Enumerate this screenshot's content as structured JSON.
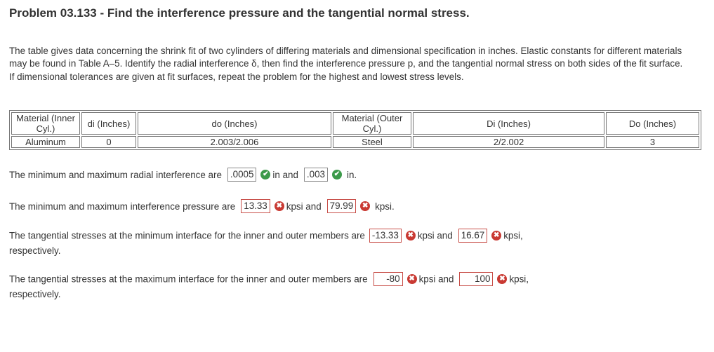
{
  "problem": {
    "title": "Problem 03.133 - Find the interference pressure and the tangential normal stress.",
    "description": "The table gives data concerning the shrink fit of two cylinders of differing materials and dimensional specification in inches. Elastic constants for different materials may be found in Table A–5. Identify the radial interference δ, then find the interference pressure p, and the tangential normal stress on both sides of the fit surface. If dimensional tolerances are given at fit surfaces, repeat the problem for the highest and lowest stress levels."
  },
  "table": {
    "headers": [
      "Material (Inner Cyl.)",
      "di (Inches)",
      "do (Inches)",
      "Material (Outer Cyl.)",
      "Di (Inches)",
      "Do (Inches)"
    ],
    "row": [
      "Aluminum",
      "0",
      "2.003/2.006",
      "Steel",
      "2/2.002",
      "3"
    ]
  },
  "q1": {
    "prefix": "The minimum and maximum radial interference are",
    "a1": ".0005",
    "mid": "in and",
    "a2": ".003",
    "suffix": "in."
  },
  "q2": {
    "prefix": "The minimum and maximum interference pressure are",
    "a1": "13.33",
    "mid": "kpsi and",
    "a2": "79.99",
    "suffix": "kpsi."
  },
  "q3": {
    "prefix": "The tangential stresses at the minimum interface for the inner and outer members are",
    "a1": "-13.33",
    "mid": "kpsi and",
    "a2": "16.67",
    "suffix": "kpsi,",
    "tail": "respectively."
  },
  "q4": {
    "prefix": "The tangential stresses at the maximum interface for the inner and outer members are",
    "a1": "-80",
    "mid": "kpsi and",
    "a2": "100",
    "suffix": "kpsi,",
    "tail": "respectively."
  },
  "marks": {
    "correct": "✔",
    "incorrect": "✖"
  }
}
